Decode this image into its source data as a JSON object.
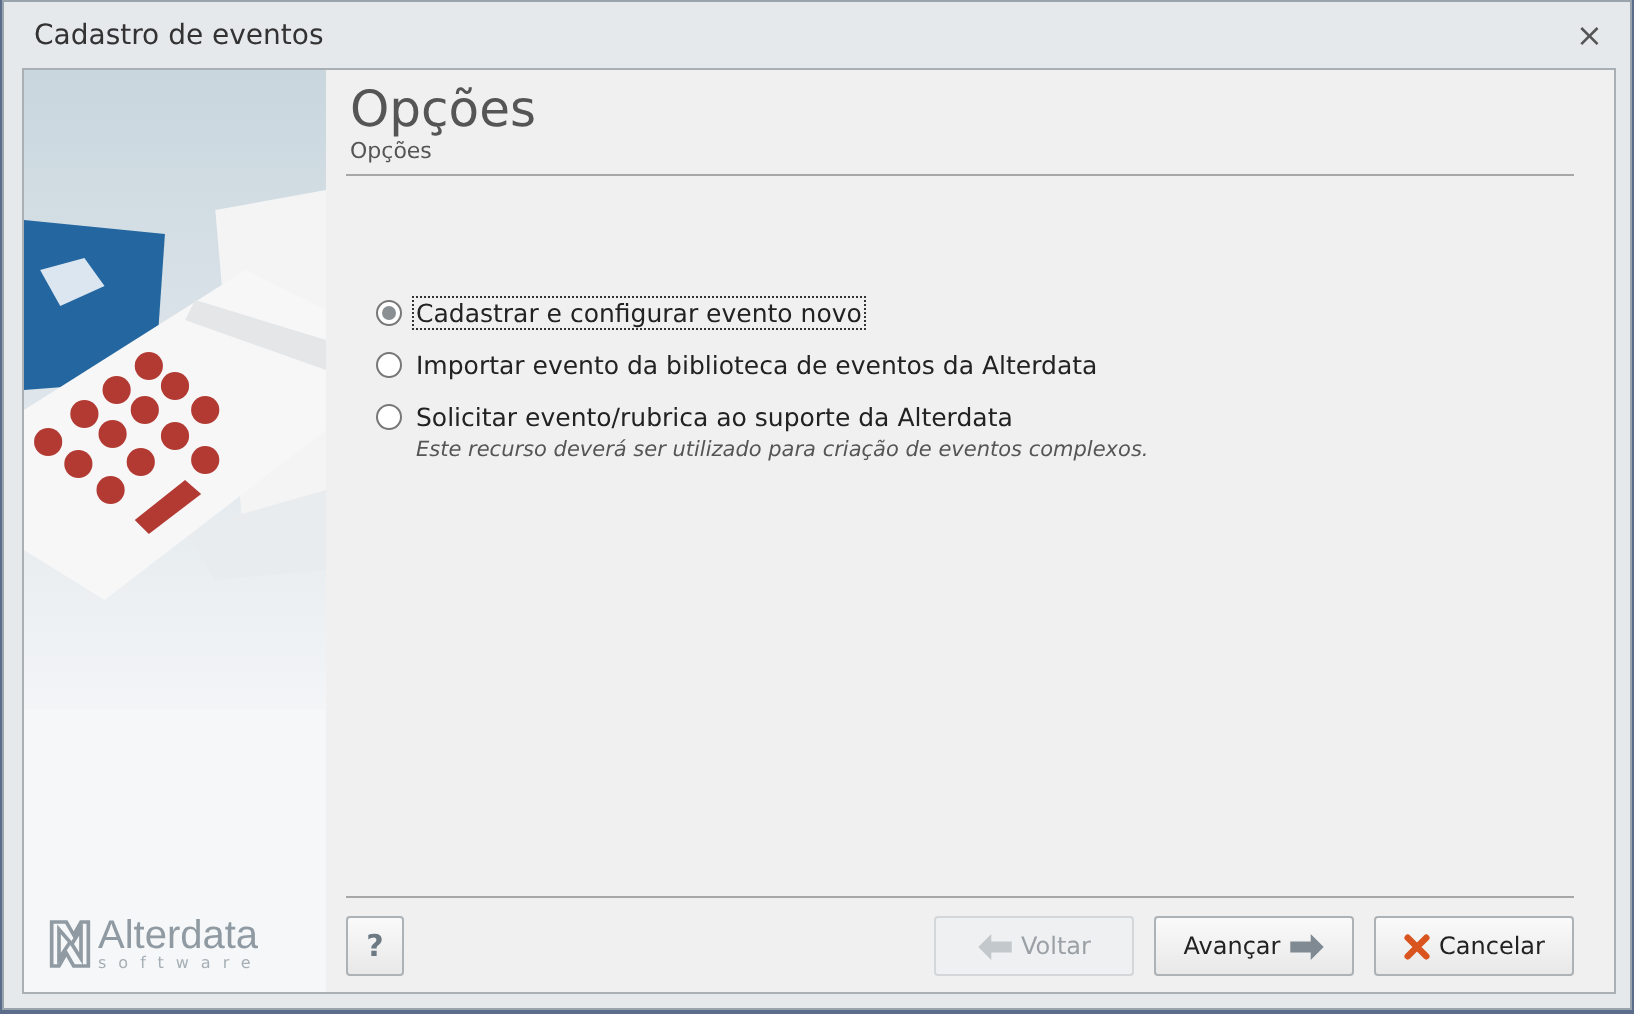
{
  "window": {
    "title": "Cadastro de eventos",
    "close": "⨯"
  },
  "sidebar": {
    "kind": "picture",
    "logo": {
      "name": "Alterdata",
      "tagline": "software"
    }
  },
  "header": {
    "title": "Opções",
    "subtitle": "Opções"
  },
  "options": [
    {
      "label": "Cadastrar e configurar evento novo",
      "selected": true,
      "focused": true
    },
    {
      "label": "Importar evento da biblioteca de eventos da Alterdata",
      "selected": false,
      "focused": false
    },
    {
      "label": "Solicitar evento/rubrica ao suporte da Alterdata",
      "selected": false,
      "focused": false,
      "note": "Este recurso deverá ser utilizado para criação de eventos complexos."
    }
  ],
  "help_button": "?",
  "buttons": [
    {
      "label": "Voltar",
      "kind": "back",
      "disabled": true
    },
    {
      "label": "Avançar",
      "kind": "next",
      "disabled": false
    },
    {
      "label": "Cancelar",
      "kind": "cancel",
      "disabled": false
    }
  ]
}
